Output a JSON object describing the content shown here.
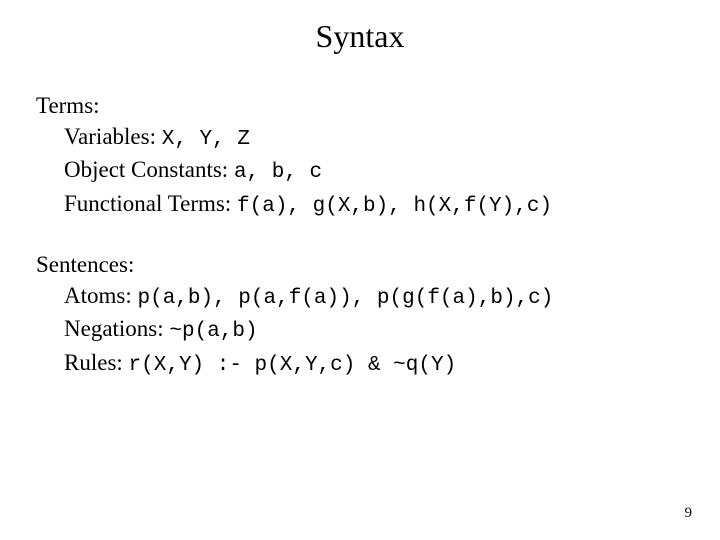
{
  "title": "Syntax",
  "terms": {
    "header": "Terms:",
    "variables_label": "Variables: ",
    "variables_code": "X, Y, Z",
    "constants_label": "Object Constants: ",
    "constants_code": "a, b, c",
    "functional_label": "Functional Terms: ",
    "functional_code": "f(a), g(X,b), h(X,f(Y),c)"
  },
  "sentences": {
    "header": "Sentences:",
    "atoms_label": "Atoms: ",
    "atoms_code": "p(a,b), p(a,f(a)), p(g(f(a),b),c)",
    "negations_label": "Negations: ",
    "negations_code": "~p(a,b)",
    "rules_label": "Rules: ",
    "rules_code": "r(X,Y) :- p(X,Y,c) & ~q(Y)"
  },
  "page_number": "9"
}
